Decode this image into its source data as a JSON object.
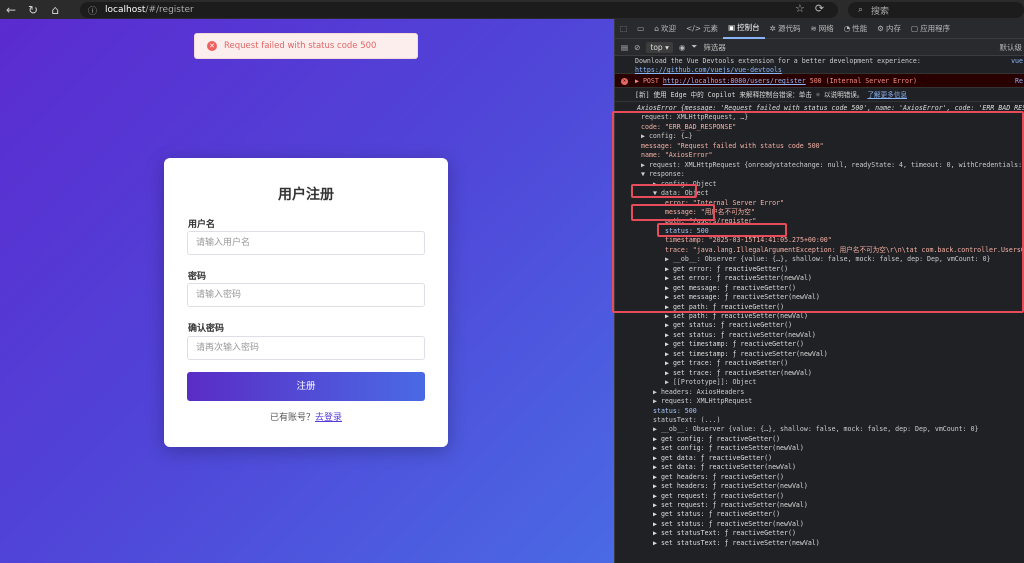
{
  "browser": {
    "url_host": "localhost",
    "url_path": "/#/register",
    "search_placeholder": "搜索"
  },
  "toast": {
    "text": "Request failed with status code 500"
  },
  "form": {
    "title": "用户注册",
    "username_label": "用户名",
    "username_placeholder": "请输入用户名",
    "password_label": "密码",
    "password_placeholder": "请输入密码",
    "confirm_label": "确认密码",
    "confirm_placeholder": "请再次输入密码",
    "submit_label": "注册",
    "login_prompt": "已有账号？",
    "login_link": "去登录"
  },
  "devtools": {
    "tabs": [
      "欢迎",
      "元素",
      "控制台",
      "源代码",
      "网络",
      "性能",
      "内存",
      "应用程序"
    ],
    "active_tab": "控制台",
    "context": "top",
    "filter_placeholder": "筛选器",
    "levels": "默认级",
    "vue_notice": "Download the Vue Devtools extension for a better development experience:",
    "vue_link": "https://github.com/vuejs/vue-devtools",
    "vue_right": "vue",
    "post_method": "POST",
    "post_url": "http://localhost:8080/users/register",
    "post_status": "500 (Internal Server Error)",
    "post_right": "Re",
    "copilot_text": "[新] 使用 Edge 中的 Copilot 来解释控制台错误：单击",
    "copilot_text2": "以说明错误。",
    "copilot_link": "了解更多信息",
    "tree": [
      {
        "indent": 0,
        "text": "AxiosError {message: 'Request failed with status code 500', name: 'AxiosError', code: 'ERR_BAD_RES"
      },
      {
        "indent": 1,
        "text": "request: XMLHttpRequest, …}"
      },
      {
        "indent": 1,
        "text": "code: \"ERR_BAD_RESPONSE\""
      },
      {
        "indent": 1,
        "text": "▶ config: {…}"
      },
      {
        "indent": 1,
        "text": "message: \"Request failed with status code 500\""
      },
      {
        "indent": 1,
        "text": "name: \"AxiosError\""
      },
      {
        "indent": 1,
        "text": "▶ request: XMLHttpRequest {onreadystatechange: null, readyState: 4, timeout: 0, withCredentials: f"
      },
      {
        "indent": 1,
        "text": "▼ response:"
      },
      {
        "indent": 2,
        "text": "▶ config: Object"
      },
      {
        "indent": 2,
        "text": "▼ data: Object"
      },
      {
        "indent": 3,
        "text": "error: \"Internal Server Error\""
      },
      {
        "indent": 3,
        "text": "message: \"用户名不可为空\""
      },
      {
        "indent": 3,
        "text": "path: \"/users/register\""
      },
      {
        "indent": 3,
        "text": "status: 500"
      },
      {
        "indent": 3,
        "text": "timestamp: \"2025-03-15T14:41:05.275+00:00\""
      },
      {
        "indent": 3,
        "text": "trace: \"java.lang.IllegalArgumentException: 用户名不可为空\\r\\n\\tat com.back.controller.UsersCo"
      },
      {
        "indent": 3,
        "text": "▶ __ob__: Observer {value: {…}, shallow: false, mock: false, dep: Dep, vmCount: 0}"
      },
      {
        "indent": 3,
        "text": "▶ get error: ƒ reactiveGetter()"
      },
      {
        "indent": 3,
        "text": "▶ set error: ƒ reactiveSetter(newVal)"
      },
      {
        "indent": 3,
        "text": "▶ get message: ƒ reactiveGetter()"
      },
      {
        "indent": 3,
        "text": "▶ set message: ƒ reactiveSetter(newVal)"
      },
      {
        "indent": 3,
        "text": "▶ get path: ƒ reactiveGetter()"
      },
      {
        "indent": 3,
        "text": "▶ set path: ƒ reactiveSetter(newVal)"
      },
      {
        "indent": 3,
        "text": "▶ get status: ƒ reactiveGetter()"
      },
      {
        "indent": 3,
        "text": "▶ set status: ƒ reactiveSetter(newVal)"
      },
      {
        "indent": 3,
        "text": "▶ get timestamp: ƒ reactiveGetter()"
      },
      {
        "indent": 3,
        "text": "▶ set timestamp: ƒ reactiveSetter(newVal)"
      },
      {
        "indent": 3,
        "text": "▶ get trace: ƒ reactiveGetter()"
      },
      {
        "indent": 3,
        "text": "▶ set trace: ƒ reactiveSetter(newVal)"
      },
      {
        "indent": 3,
        "text": "▶ [[Prototype]]: Object"
      },
      {
        "indent": 2,
        "text": "▶ headers: AxiosHeaders"
      },
      {
        "indent": 2,
        "text": "▶ request: XMLHttpRequest"
      },
      {
        "indent": 2,
        "text": "status: 500"
      },
      {
        "indent": 2,
        "text": "statusText: (...)"
      },
      {
        "indent": 2,
        "text": "▶ __ob__: Observer {value: {…}, shallow: false, mock: false, dep: Dep, vmCount: 0}"
      },
      {
        "indent": 2,
        "text": "▶ get config: ƒ reactiveGetter()"
      },
      {
        "indent": 2,
        "text": "▶ set config: ƒ reactiveSetter(newVal)"
      },
      {
        "indent": 2,
        "text": "▶ get data: ƒ reactiveGetter()"
      },
      {
        "indent": 2,
        "text": "▶ set data: ƒ reactiveSetter(newVal)"
      },
      {
        "indent": 2,
        "text": "▶ get headers: ƒ reactiveGetter()"
      },
      {
        "indent": 2,
        "text": "▶ set headers: ƒ reactiveSetter(newVal)"
      },
      {
        "indent": 2,
        "text": "▶ get request: ƒ reactiveGetter()"
      },
      {
        "indent": 2,
        "text": "▶ set request: ƒ reactiveSetter(newVal)"
      },
      {
        "indent": 2,
        "text": "▶ get status: ƒ reactiveGetter()"
      },
      {
        "indent": 2,
        "text": "▶ set status: ƒ reactiveSetter(newVal)"
      },
      {
        "indent": 2,
        "text": "▶ set statusText: ƒ reactiveGetter()"
      },
      {
        "indent": 2,
        "text": "▶ set statusText: ƒ reactiveSetter(newVal)"
      }
    ],
    "highlight_color": "#e84b5a"
  }
}
